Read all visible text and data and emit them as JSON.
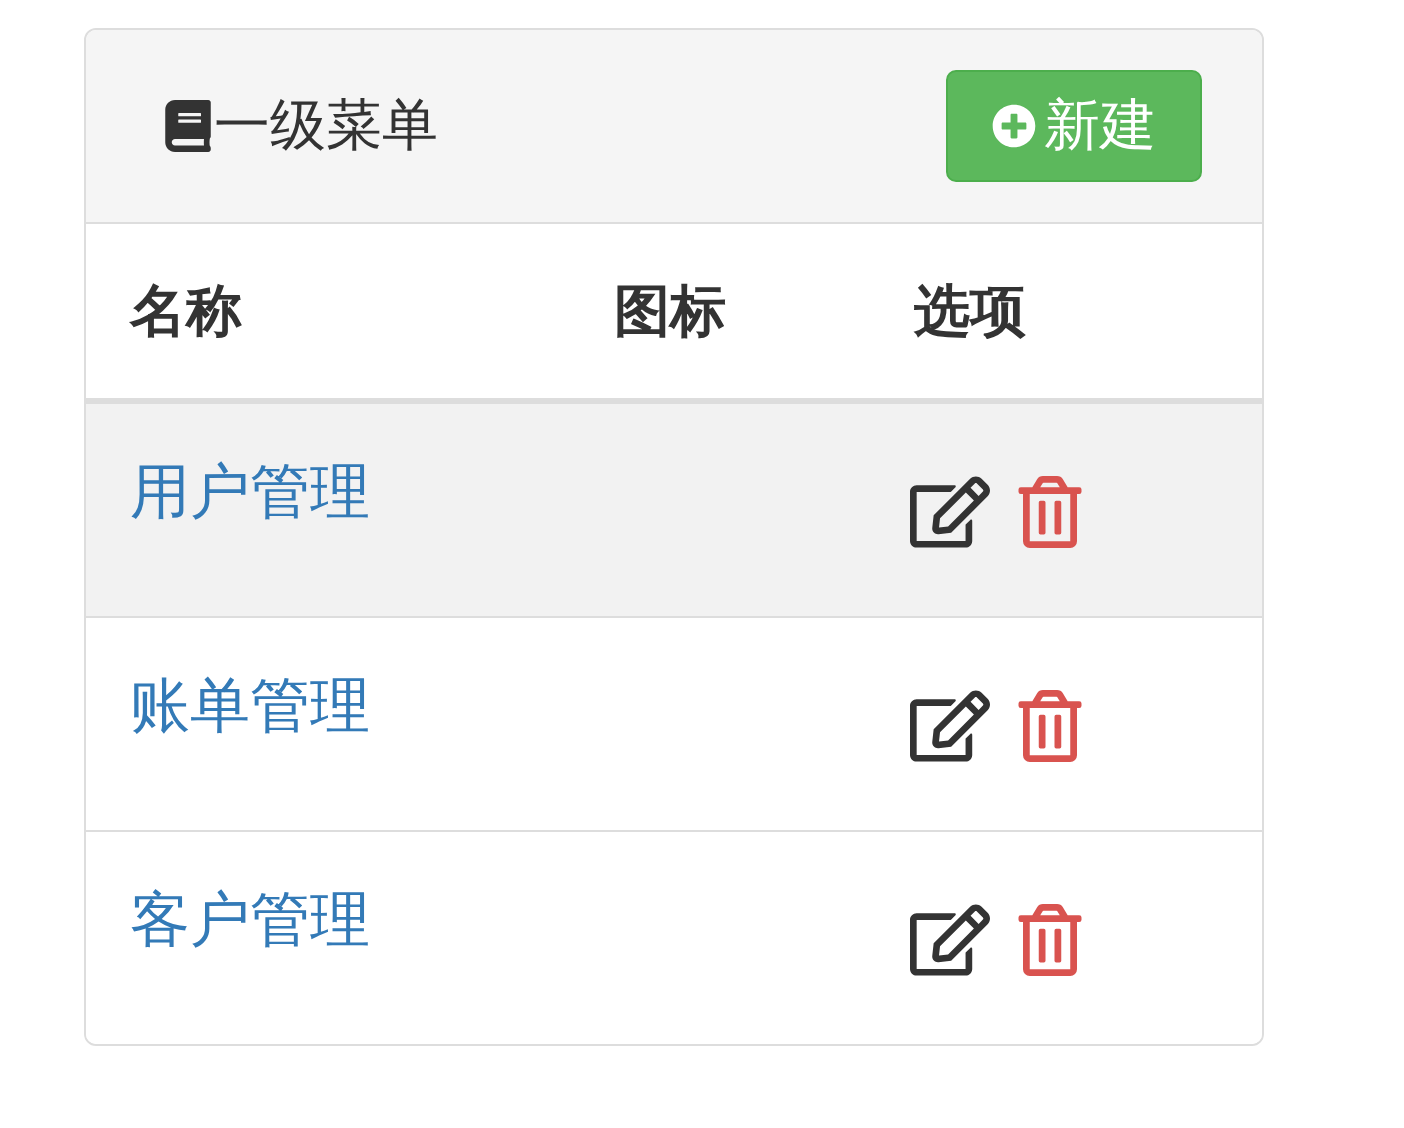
{
  "panel": {
    "title": "一级菜单",
    "new_button": "新建"
  },
  "table": {
    "columns": [
      "名称",
      "图标",
      "选项"
    ],
    "rows": [
      {
        "name": "用户管理",
        "selected": true
      },
      {
        "name": "账单管理",
        "selected": false
      },
      {
        "name": "客户管理",
        "selected": false
      }
    ]
  }
}
